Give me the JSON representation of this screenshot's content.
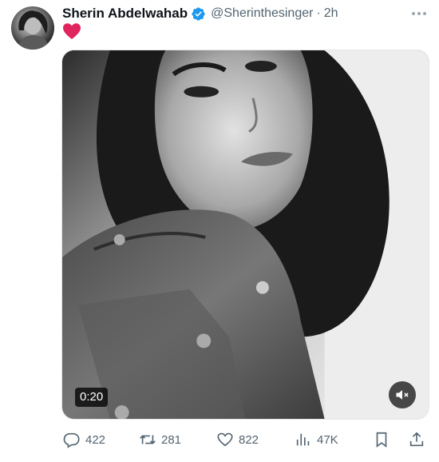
{
  "tweet": {
    "author": {
      "display_name": "Sherin Abdelwahab",
      "handle": "@Sherinthesinger",
      "verified": true,
      "verified_color": "#1d9bf0"
    },
    "separator": "·",
    "timestamp": "2h",
    "text_emoji": "heart",
    "emoji_color": "#e0245e",
    "media": {
      "type": "video",
      "duration": "0:20",
      "muted": true,
      "icons": [
        "volume-muted-icon"
      ]
    },
    "actions": {
      "replies": "422",
      "retweets": "281",
      "likes": "822",
      "views": "47K"
    },
    "icons": {
      "reply": "reply-icon",
      "retweet": "retweet-icon",
      "like": "like-icon",
      "views": "views-icon",
      "bookmark": "bookmark-icon",
      "share": "share-icon",
      "more": "more-icon"
    },
    "colors": {
      "text": "#0f1419",
      "secondary": "#536471"
    }
  }
}
